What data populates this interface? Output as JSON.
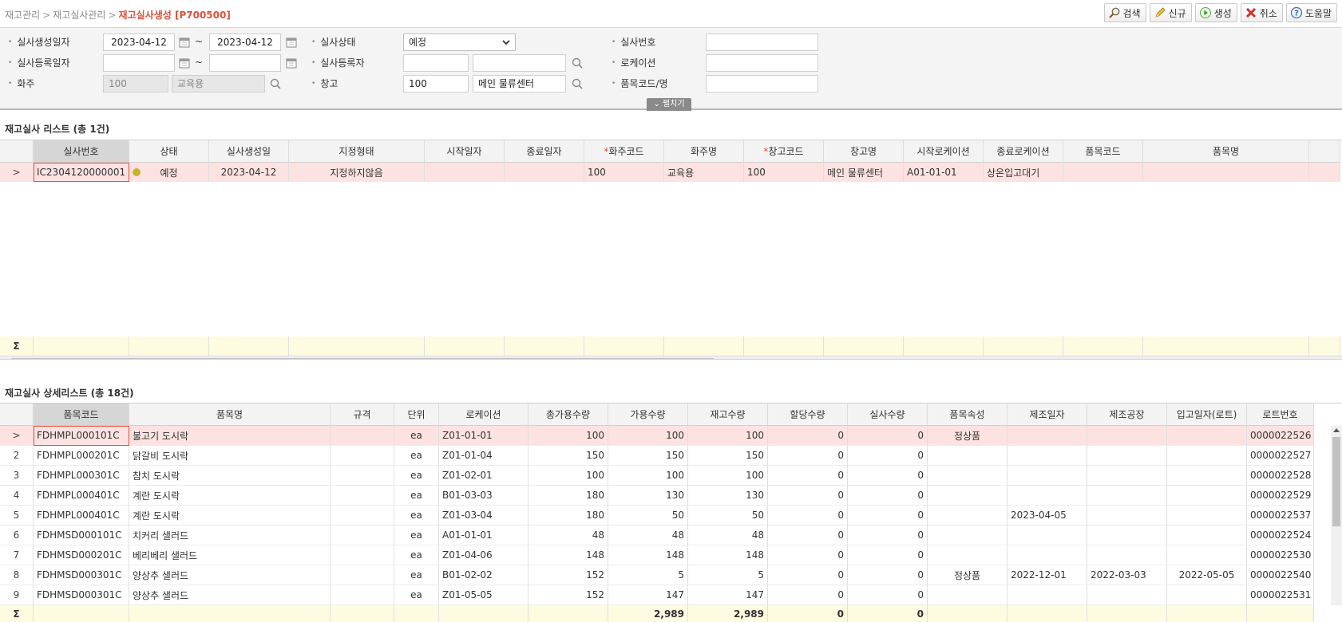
{
  "breadcrumb": {
    "items": [
      "재고관리",
      "재고실사관리"
    ],
    "current": "재고실사생성 [P700500]"
  },
  "toolbar": {
    "search": "검색",
    "new": "신규",
    "create": "생성",
    "cancel": "취소",
    "help": "도움말"
  },
  "search": {
    "create_date_label": "실사생성일자",
    "create_date_from": "2023-04-12",
    "create_date_to": "2023-04-12",
    "reg_date_label": "실사등록일자",
    "reg_date_from": "",
    "reg_date_to": "",
    "owner_label": "화주",
    "owner_code": "100",
    "owner_name": "교육용",
    "status_label": "실사상태",
    "status_value": "예정",
    "registrant_label": "실사등록자",
    "registrant_code": "",
    "registrant_name": "",
    "warehouse_label": "창고",
    "warehouse_code": "100",
    "warehouse_name": "메인 물류센터",
    "inspect_no_label": "실사번호",
    "inspect_no_value": "",
    "location_label": "로케이션",
    "location_value": "",
    "item_label": "품목코드/명",
    "item_value": "",
    "fold_label": "펼치기",
    "tilde": "~"
  },
  "list_grid": {
    "title": "재고실사 리스트 (총 1건)",
    "columns": [
      "실사번호",
      "상태",
      "실사생성일",
      "지정형태",
      "시작일자",
      "종료일자",
      "화주코드",
      "화주명",
      "창고코드",
      "창고명",
      "시작로케이션",
      "종료로케이션",
      "품목코드",
      "품목명"
    ],
    "required_mark": "*",
    "rows": [
      {
        "marker": ">",
        "inspect_no": "IC2304120000001",
        "status": "예정",
        "create_date": "2023-04-12",
        "designation": "지정하지않음",
        "start_date": "",
        "end_date": "",
        "owner_code": "100",
        "owner_name": "교육용",
        "wh_code": "100",
        "wh_name": "메인 물류센터",
        "start_loc": "A01-01-01",
        "end_loc": "상온입고대기",
        "item_code": "",
        "item_name": ""
      }
    ],
    "sum_symbol": "Σ"
  },
  "detail_grid": {
    "title": "재고실사 상세리스트 (총 18건)",
    "columns": [
      "품목코드",
      "품목명",
      "규격",
      "단위",
      "로케이션",
      "총가용수량",
      "가용수량",
      "재고수량",
      "할당수량",
      "실사수량",
      "품목속성",
      "제조일자",
      "제조공장",
      "입고일자(로트)",
      "로트번호"
    ],
    "rows": [
      {
        "no": ">",
        "code": "FDHMPL000101C",
        "name": "불고기 도시락",
        "spec": "",
        "unit": "ea",
        "loc": "Z01-01-01",
        "total": "100",
        "avail": "100",
        "stock": "100",
        "alloc": "0",
        "actual": "0",
        "attr": "정상품",
        "mfg_date": "",
        "factory": "",
        "in_date": "",
        "lot": "0000022526"
      },
      {
        "no": "2",
        "code": "FDHMPL000201C",
        "name": "닭갈비 도시락",
        "spec": "",
        "unit": "ea",
        "loc": "Z01-01-04",
        "total": "150",
        "avail": "150",
        "stock": "150",
        "alloc": "0",
        "actual": "0",
        "attr": "",
        "mfg_date": "",
        "factory": "",
        "in_date": "",
        "lot": "0000022527"
      },
      {
        "no": "3",
        "code": "FDHMPL000301C",
        "name": "참치 도시락",
        "spec": "",
        "unit": "ea",
        "loc": "Z01-02-01",
        "total": "100",
        "avail": "100",
        "stock": "100",
        "alloc": "0",
        "actual": "0",
        "attr": "",
        "mfg_date": "",
        "factory": "",
        "in_date": "",
        "lot": "0000022528"
      },
      {
        "no": "4",
        "code": "FDHMPL000401C",
        "name": "계란 도시락",
        "spec": "",
        "unit": "ea",
        "loc": "B01-03-03",
        "total": "180",
        "avail": "130",
        "stock": "130",
        "alloc": "0",
        "actual": "0",
        "attr": "",
        "mfg_date": "",
        "factory": "",
        "in_date": "",
        "lot": "0000022529"
      },
      {
        "no": "5",
        "code": "FDHMPL000401C",
        "name": "계란 도시락",
        "spec": "",
        "unit": "ea",
        "loc": "Z01-03-04",
        "total": "180",
        "avail": "50",
        "stock": "50",
        "alloc": "0",
        "actual": "0",
        "attr": "",
        "mfg_date": "2023-04-05",
        "factory": "",
        "in_date": "",
        "lot": "0000022537"
      },
      {
        "no": "6",
        "code": "FDHMSD000101C",
        "name": "치커리 샐러드",
        "spec": "",
        "unit": "ea",
        "loc": "A01-01-01",
        "total": "48",
        "avail": "48",
        "stock": "48",
        "alloc": "0",
        "actual": "0",
        "attr": "",
        "mfg_date": "",
        "factory": "",
        "in_date": "",
        "lot": "0000022524"
      },
      {
        "no": "7",
        "code": "FDHMSD000201C",
        "name": "베리베리 샐러드",
        "spec": "",
        "unit": "ea",
        "loc": "Z01-04-06",
        "total": "148",
        "avail": "148",
        "stock": "148",
        "alloc": "0",
        "actual": "0",
        "attr": "",
        "mfg_date": "",
        "factory": "",
        "in_date": "",
        "lot": "0000022530"
      },
      {
        "no": "8",
        "code": "FDHMSD000301C",
        "name": "양상추 샐러드",
        "spec": "",
        "unit": "ea",
        "loc": "B01-02-02",
        "total": "152",
        "avail": "5",
        "stock": "5",
        "alloc": "0",
        "actual": "0",
        "attr": "정상품",
        "mfg_date": "2022-12-01",
        "factory": "2022-03-03",
        "in_date": "2022-05-05",
        "lot": "0000022540"
      },
      {
        "no": "9",
        "code": "FDHMSD000301C",
        "name": "양상추 샐러드",
        "spec": "",
        "unit": "ea",
        "loc": "Z01-05-05",
        "total": "152",
        "avail": "147",
        "stock": "147",
        "alloc": "0",
        "actual": "0",
        "attr": "",
        "mfg_date": "",
        "factory": "",
        "in_date": "",
        "lot": "0000022531"
      }
    ],
    "sum_symbol": "Σ",
    "sum": {
      "avail": "2,989",
      "stock": "2,989",
      "alloc": "0",
      "actual": "0"
    }
  },
  "colors": {
    "accent": "#e0513a",
    "selected_row": "#fde2e2",
    "sum_row": "#fdfbe0",
    "status_dot": "#c8b42a"
  }
}
